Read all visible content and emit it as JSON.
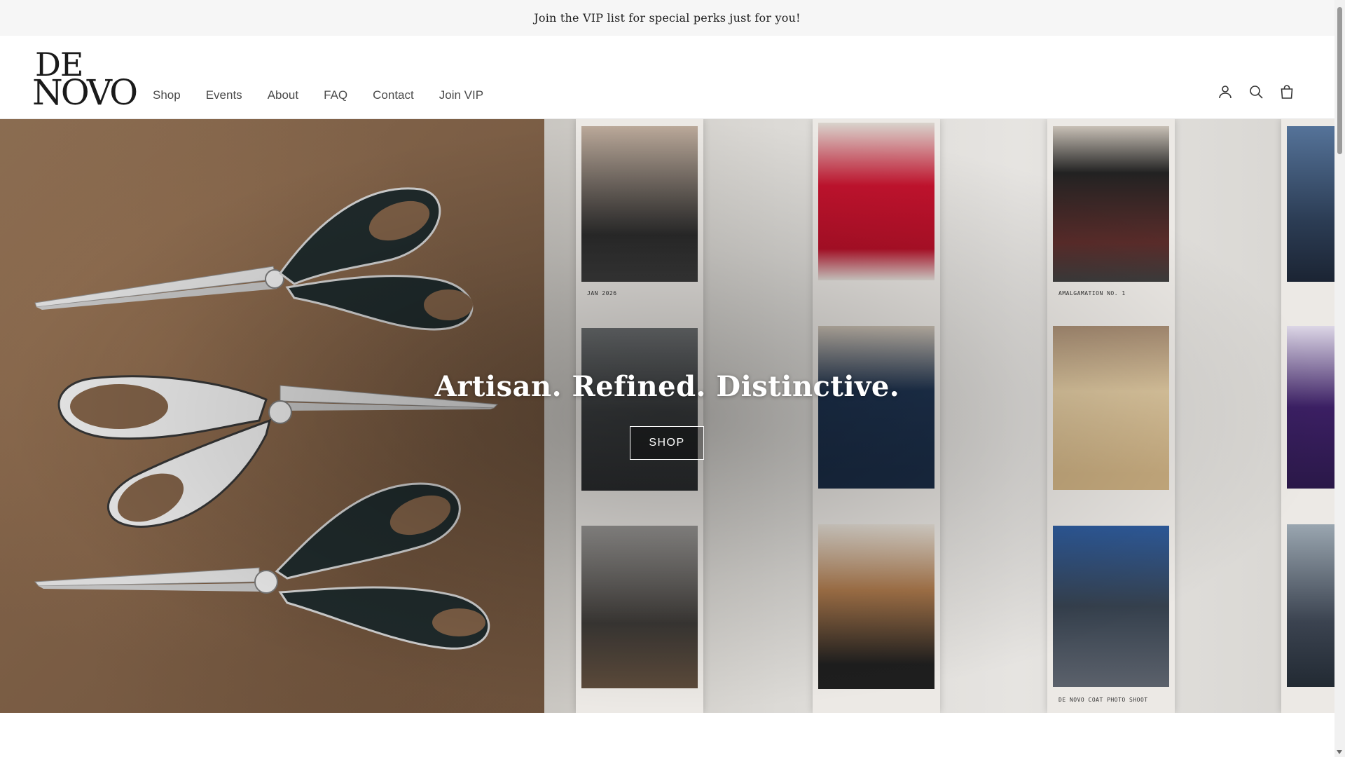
{
  "announcement": {
    "text": "Join the VIP list for special perks just for you!"
  },
  "logo": {
    "line1": "DE",
    "line2": "NOVO"
  },
  "nav": [
    {
      "label": "Shop"
    },
    {
      "label": "Events"
    },
    {
      "label": "About"
    },
    {
      "label": "FAQ"
    },
    {
      "label": "Contact"
    },
    {
      "label": "Join VIP"
    }
  ],
  "header_icons": [
    "account-icon",
    "search-icon",
    "cart-bag-icon"
  ],
  "hero": {
    "heading": "Artisan. Refined. Distinctive.",
    "button_label": "SHOP",
    "captions": {
      "c1": "JAN 2026",
      "c2": "AMALGAMATION NO. 1",
      "c3": "DE NOVO COAT PHOTO SHOOT"
    }
  },
  "colors": {
    "announcement_bg": "#f6f6f6",
    "text_dark": "#1d1d1d",
    "nav_text": "#4a4a4a",
    "hero_left_brown": "#7d5f46"
  }
}
